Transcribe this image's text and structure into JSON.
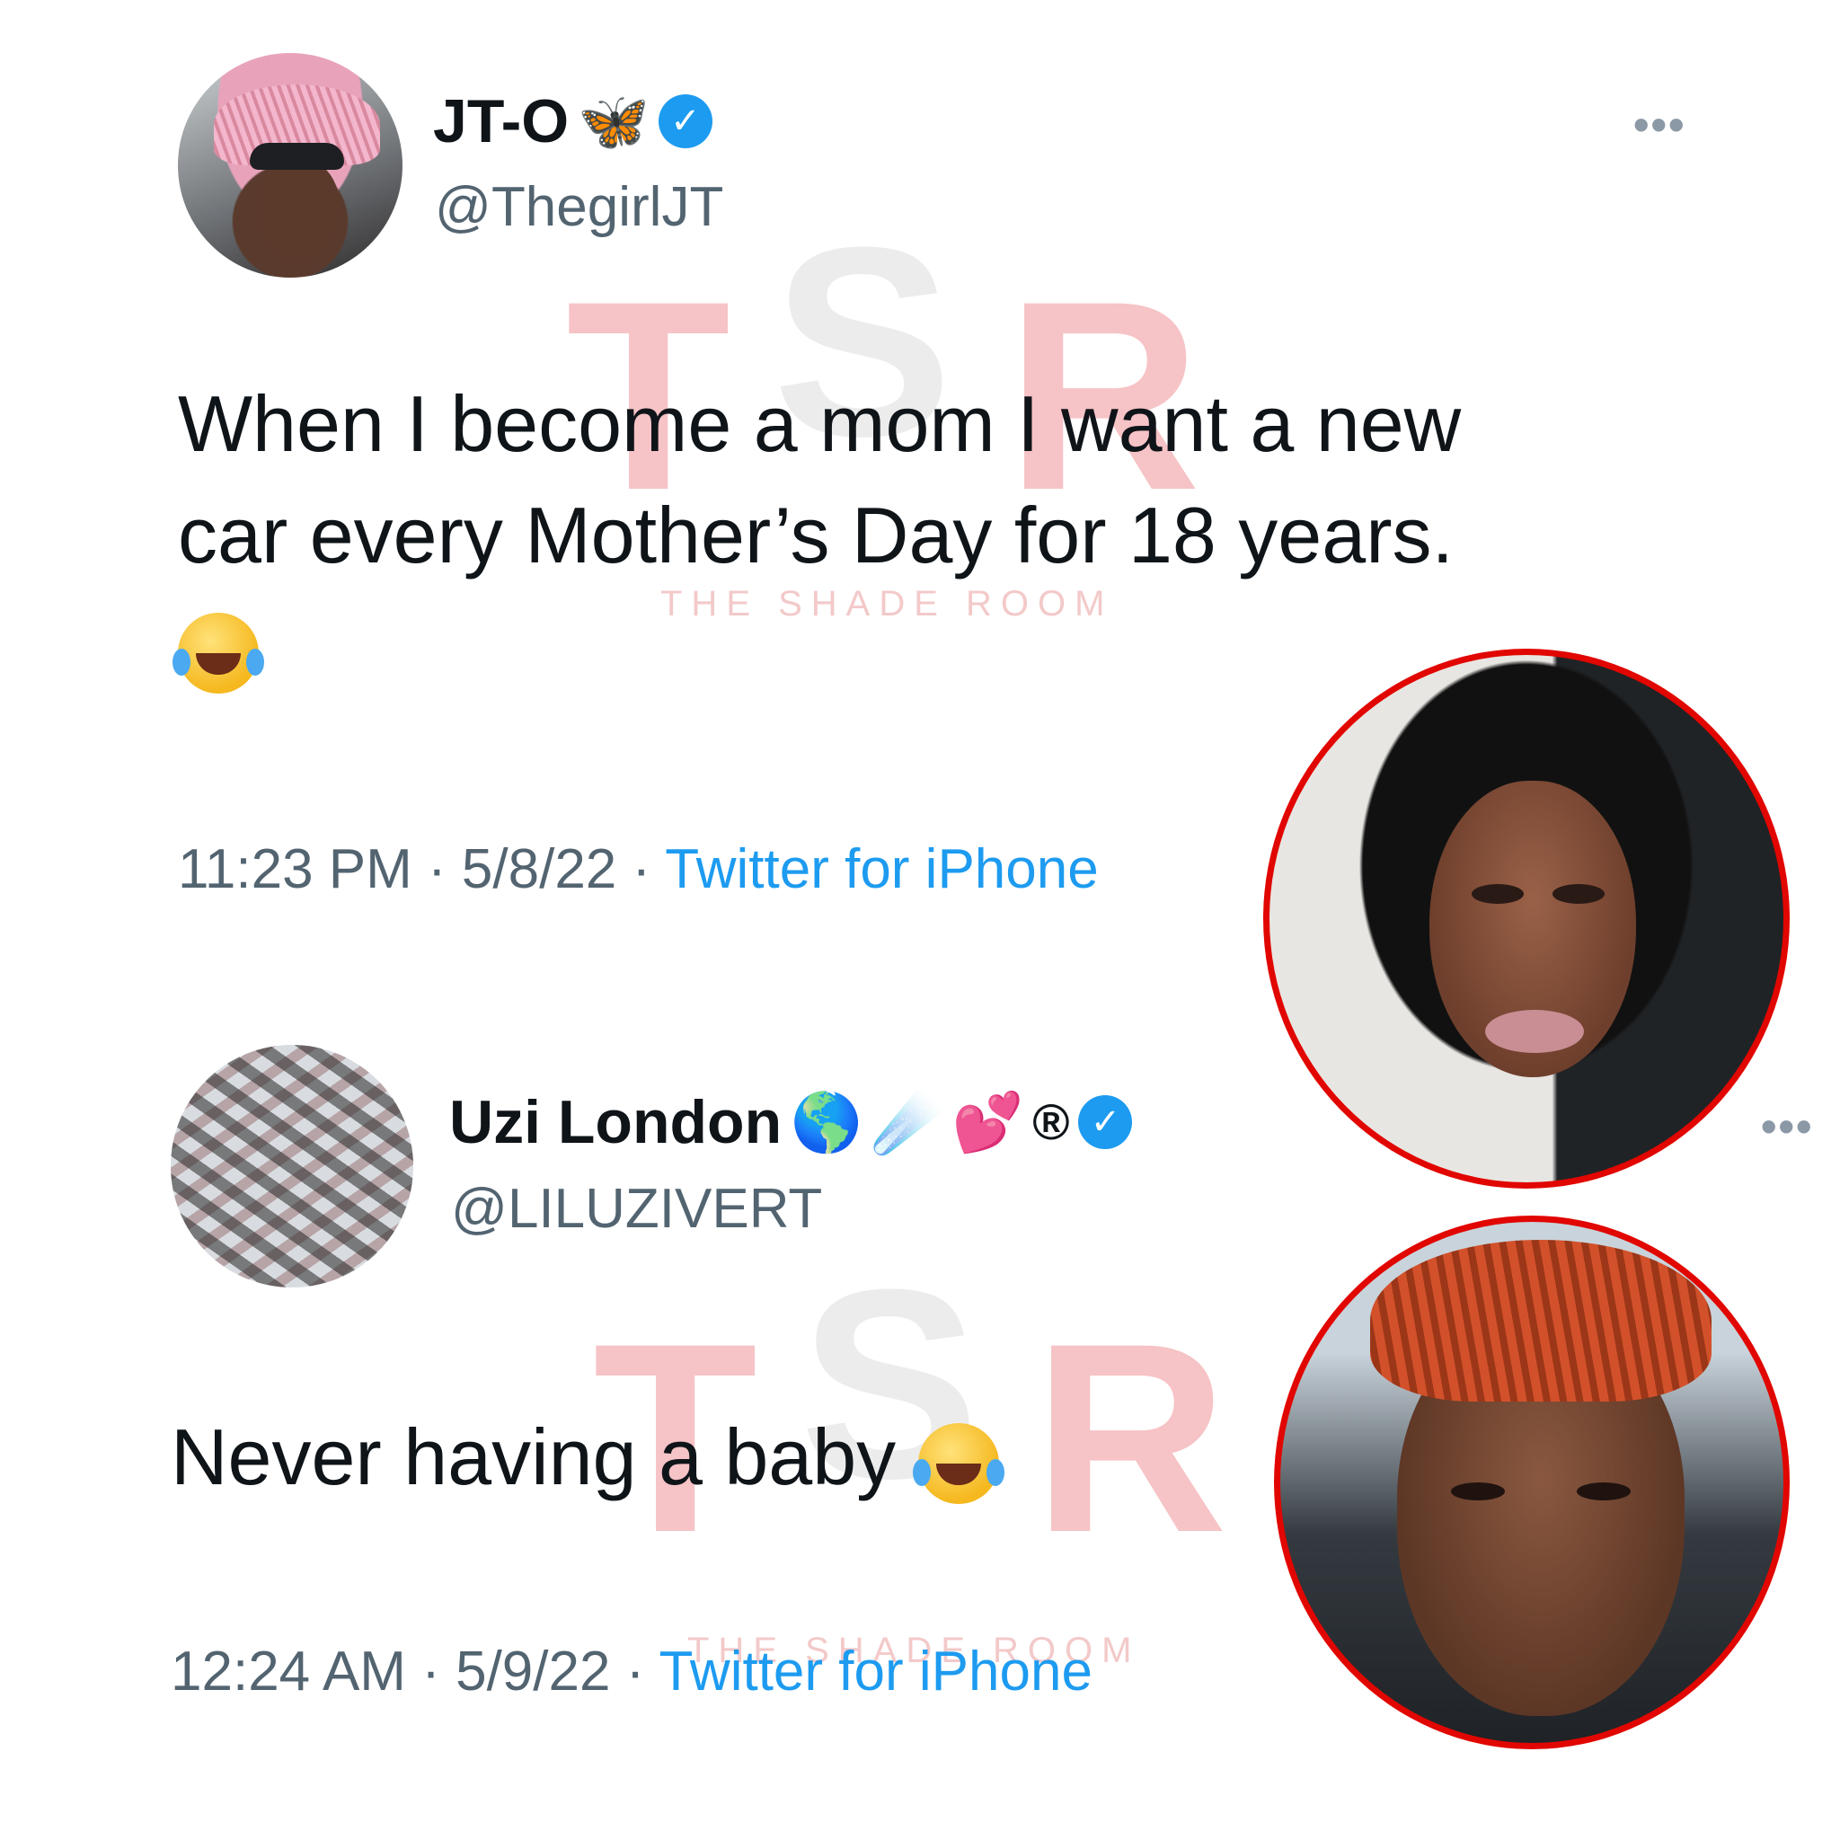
{
  "tweets": [
    {
      "display_name": "JT-O",
      "name_emojis": [
        "🦋"
      ],
      "handle": "@ThegirlJT",
      "text_line1": "When I become a mom I want a new",
      "text_line2": "car every Mother’s Day for 18 years.",
      "time": "11:23 PM",
      "date": "5/8/22",
      "separator": "·",
      "source": "Twitter for iPhone"
    },
    {
      "display_name": "Uzi London",
      "name_emojis": [
        "🌎",
        "☄️",
        "💕",
        "®"
      ],
      "handle": "@LILUZIVERT",
      "text": "Never having a baby",
      "time": "12:24 AM",
      "date": "5/9/22",
      "separator": "·",
      "source": "Twitter for iPhone"
    }
  ],
  "watermark": {
    "letters": [
      "T",
      "S",
      "R"
    ],
    "tagline": "THE SHADE ROOM"
  },
  "icons": {
    "verified": "verified-badge-icon",
    "more": "more-options-icon",
    "emoji": "tears-of-joy-emoji"
  },
  "glyphs": {
    "more": "•••",
    "check": "✓"
  },
  "colors": {
    "accent": "#1d9bf0",
    "ring": "#e10600",
    "watermark": "#f6c3c6"
  }
}
